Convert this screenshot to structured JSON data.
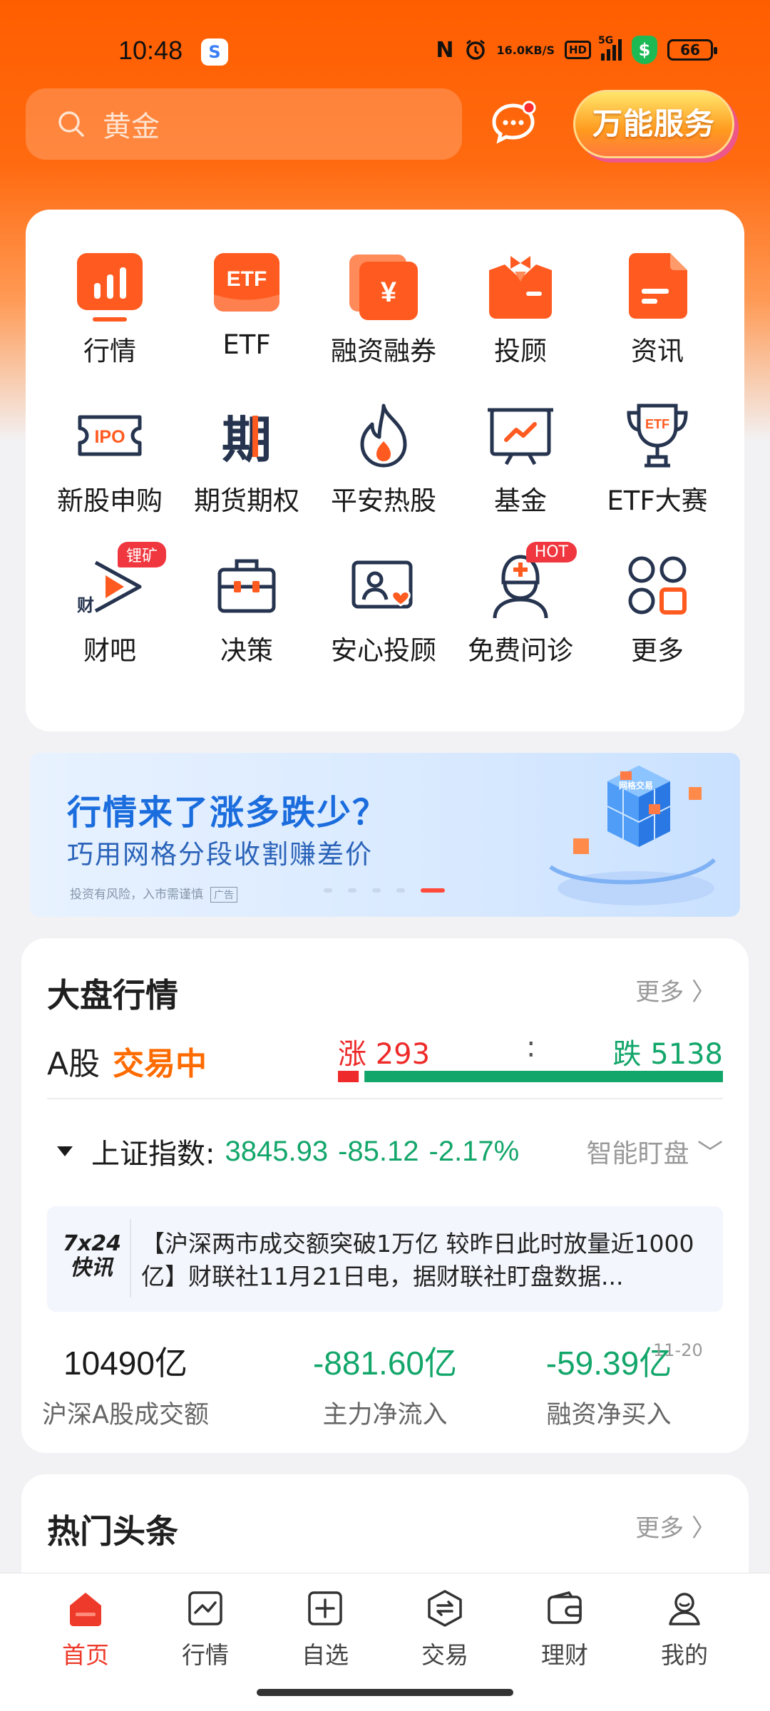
{
  "status_bar": {
    "time": "10:48",
    "net_speed_top": "16.0",
    "net_speed_unit": "KB/S",
    "hd": "HD",
    "network": "5G",
    "battery": "66",
    "app_badge": "S"
  },
  "header": {
    "search_placeholder": "黄金",
    "service_button": "万能服务"
  },
  "menu": [
    {
      "label": "行情",
      "icon": "chart-bars-icon"
    },
    {
      "label": "ETF",
      "icon": "etf-icon"
    },
    {
      "label": "融资融券",
      "icon": "yen-card-icon"
    },
    {
      "label": "投顾",
      "icon": "advisor-icon"
    },
    {
      "label": "资讯",
      "icon": "news-doc-icon"
    },
    {
      "label": "新股申购",
      "icon": "ipo-ticket-icon"
    },
    {
      "label": "期货期权",
      "icon": "futures-icon"
    },
    {
      "label": "平安热股",
      "icon": "fire-icon"
    },
    {
      "label": "基金",
      "icon": "fund-chart-icon"
    },
    {
      "label": "ETF大赛",
      "icon": "etf-trophy-icon"
    },
    {
      "label": "财吧",
      "icon": "play-cai-icon",
      "badge": "锂矿"
    },
    {
      "label": "决策",
      "icon": "toolbox-icon"
    },
    {
      "label": "安心投顾",
      "icon": "profile-heart-icon"
    },
    {
      "label": "免费问诊",
      "icon": "doctor-icon",
      "badge": "HOT"
    },
    {
      "label": "更多",
      "icon": "grid-more-icon"
    }
  ],
  "banner": {
    "title": "行情来了涨多跌少？",
    "subtitle": "巧用网格分段收割赚差价",
    "note": "投资有风险，入市需谨慎",
    "ad_tag": "广告",
    "cube_text": "网格交易"
  },
  "market": {
    "title": "大盘行情",
    "more": "更多",
    "a_label": "A股",
    "a_status": "交易中",
    "rise_label": "涨 293",
    "fall_label": "跌 5138",
    "separator": ":",
    "rise_count": 293,
    "fall_count": 5138,
    "index_name": "上证指数:",
    "index_value": "3845.93",
    "index_change": "-85.12",
    "index_pct": "-2.17%",
    "smart_watch": "智能盯盘",
    "news_logo_top": "7x24",
    "news_logo_bottom": "快讯",
    "news_text": "【沪深两市成交额突破1万亿 较昨日此时放量近1000亿】财联社11月21日电，据财联社盯盘数据...",
    "stats": [
      {
        "value": "10490亿",
        "label": "沪深A股成交额"
      },
      {
        "value": "-881.60亿",
        "label": "主力净流入"
      },
      {
        "value": "-59.39亿",
        "label": "融资净买入"
      }
    ],
    "stats_date": "11-20"
  },
  "hot": {
    "title": "热门头条",
    "more": "更多"
  },
  "tabbar": [
    {
      "label": "首页",
      "icon": "home-icon",
      "active": true
    },
    {
      "label": "行情",
      "icon": "market-chart-icon"
    },
    {
      "label": "自选",
      "icon": "add-watchlist-icon"
    },
    {
      "label": "交易",
      "icon": "trade-exchange-icon"
    },
    {
      "label": "理财",
      "icon": "wallet-icon"
    },
    {
      "label": "我的",
      "icon": "user-icon"
    }
  ],
  "colors": {
    "brand": "#ff5e00",
    "rise": "#ee2a2a",
    "fall": "#13a66a",
    "status": "#ff6b00"
  }
}
